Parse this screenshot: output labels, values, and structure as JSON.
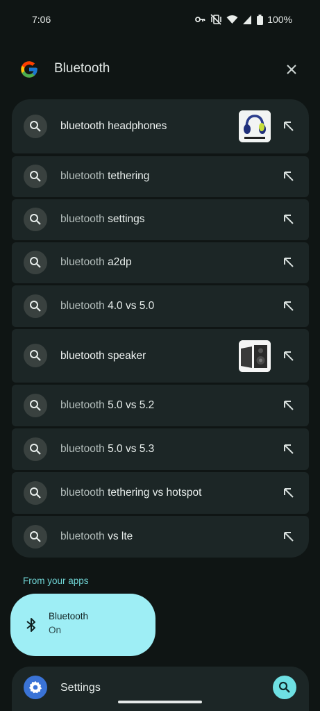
{
  "status": {
    "time": "7:06",
    "battery": "100%",
    "icons": [
      "vpn-key-icon",
      "vibrate-off-icon",
      "wifi-icon",
      "cellular-signal-icon",
      "battery-icon"
    ]
  },
  "search": {
    "query": "Bluetooth",
    "logo": "google-g-logo",
    "clear_icon": "close-icon"
  },
  "suggestions": [
    {
      "text": "bluetooth headphones",
      "pre": "",
      "post": "",
      "bold": true,
      "thumbnail": "headphones-image"
    },
    {
      "text": "",
      "pre": "bluetooth ",
      "post": "tethering",
      "bold": false
    },
    {
      "text": "",
      "pre": "bluetooth ",
      "post": "settings",
      "bold": false
    },
    {
      "text": "",
      "pre": "bluetooth ",
      "post": "a2dp",
      "bold": false
    },
    {
      "text": "",
      "pre": "bluetooth ",
      "post": "4.0 vs 5.0",
      "bold": false
    },
    {
      "text": "bluetooth speaker",
      "pre": "",
      "post": "",
      "bold": true,
      "thumbnail": "speaker-image"
    },
    {
      "text": "",
      "pre": "bluetooth ",
      "post": "5.0 vs 5.2",
      "bold": false
    },
    {
      "text": "",
      "pre": "bluetooth ",
      "post": "5.0 vs 5.3",
      "bold": false
    },
    {
      "text": "",
      "pre": "bluetooth ",
      "post": "tethering vs hotspot",
      "bold": false
    },
    {
      "text": "",
      "pre": "bluetooth ",
      "post": "vs lte",
      "bold": false
    }
  ],
  "apps_section": {
    "header": "From your apps",
    "card": {
      "name": "Bluetooth",
      "status": "On",
      "icon": "bluetooth-icon"
    }
  },
  "settings_result": {
    "label": "Settings",
    "icon": "gear-icon",
    "action_icon": "search-icon"
  },
  "colors": {
    "background": "#0f1514",
    "card": "#1c2626",
    "accent": "#6fd4d4",
    "app_card": "#9eeef5"
  }
}
